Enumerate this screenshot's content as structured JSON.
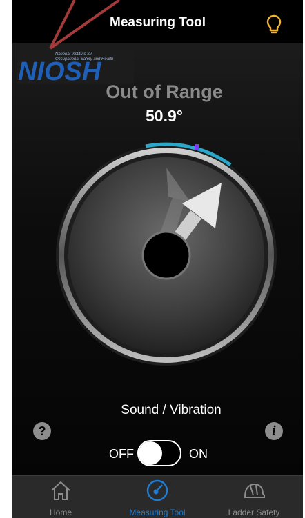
{
  "nav": {
    "title": "Measuring Tool"
  },
  "logo": {
    "wordmark": "NIOSH",
    "subtitle_line1": "National Institute for",
    "subtitle_line2": "Occupational Safety and Health"
  },
  "reading": {
    "status": "Out of Range",
    "angle": "50.9°"
  },
  "controls": {
    "sound_label": "Sound / Vibration",
    "toggle_off": "OFF",
    "toggle_on": "ON",
    "toggle_state": "off"
  },
  "tabs": [
    {
      "label": "Home",
      "icon": "home-icon",
      "active": false
    },
    {
      "label": "Measuring Tool",
      "icon": "gauge-icon",
      "active": true
    },
    {
      "label": "Ladder Safety",
      "icon": "hard-hat-icon",
      "active": false
    }
  ],
  "colors": {
    "accent": "#1e7cd3",
    "indicator": "#2aa7c9",
    "marker": "#7a3cff",
    "annotation": "#a33a3a"
  }
}
